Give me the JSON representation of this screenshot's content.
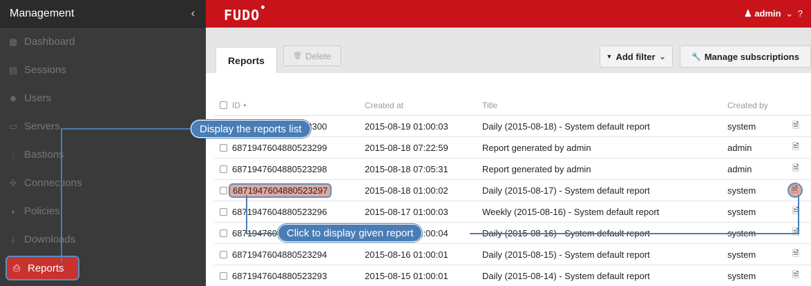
{
  "sidebar": {
    "title": "Management",
    "collapse_glyph": "‹",
    "items": [
      {
        "label": "Dashboard",
        "icon": "dashboard-icon",
        "glyph": "▦"
      },
      {
        "label": "Sessions",
        "icon": "film-icon",
        "glyph": "▤"
      },
      {
        "label": "Users",
        "icon": "users-icon",
        "glyph": "☻"
      },
      {
        "label": "Servers",
        "icon": "server-icon",
        "glyph": "▭"
      },
      {
        "label": "Bastions",
        "icon": "bastion-icon",
        "glyph": "⋮"
      },
      {
        "label": "Connections",
        "icon": "connections-icon",
        "glyph": "✢"
      },
      {
        "label": "Policies",
        "icon": "shield-icon",
        "glyph": "◗"
      },
      {
        "label": "Downloads",
        "icon": "download-icon",
        "glyph": "⤓"
      },
      {
        "label": "Reports",
        "icon": "print-icon",
        "glyph": "⎙",
        "active": true
      }
    ]
  },
  "topbar": {
    "logo": "FUDO",
    "user": "admin",
    "user_glyph": "♟",
    "user_chevron": "⌄",
    "help": "?"
  },
  "toolbar": {
    "tab_label": "Reports",
    "delete_label": "Delete",
    "delete_glyph": "🗑",
    "add_filter_label": "Add filter",
    "add_filter_glyph": "▼",
    "add_filter_chevron": "⌄",
    "subscriptions_label": "Manage subscriptions",
    "subscriptions_glyph": "🔧"
  },
  "table": {
    "headers": {
      "id": "ID",
      "sort_glyph": "▲",
      "created_at": "Created at",
      "title": "Title",
      "created_by": "Created by"
    },
    "rows": [
      {
        "id": "6871947604880523300",
        "created_at": "2015-08-19 01:00:03",
        "title": "Daily (2015-08-18) - System default report",
        "created_by": "system"
      },
      {
        "id": "6871947604880523299",
        "created_at": "2015-08-18 07:22:59",
        "title": "Report generated by admin",
        "created_by": "admin"
      },
      {
        "id": "6871947604880523298",
        "created_at": "2015-08-18 07:05:31",
        "title": "Report generated by admin",
        "created_by": "admin"
      },
      {
        "id": "6871947604880523297",
        "created_at": "2015-08-18 01:00:02",
        "title": "Daily (2015-08-17) - System default report",
        "created_by": "system"
      },
      {
        "id": "6871947604880523296",
        "created_at": "2015-08-17 01:00:03",
        "title": "Weekly (2015-08-16) - System default report",
        "created_by": "system"
      },
      {
        "id": "6871947604880523295",
        "created_at": "2015-08-16 01:00:04",
        "title": "Daily (2015-08-16) - System default report",
        "created_by": "system"
      },
      {
        "id": "6871947604880523294",
        "created_at": "2015-08-16 01:00:01",
        "title": "Daily (2015-08-15) - System default report",
        "created_by": "system"
      },
      {
        "id": "6871947604880523293",
        "created_at": "2015-08-15 01:00:01",
        "title": "Daily (2015-08-14) - System default report",
        "created_by": "system"
      }
    ],
    "action_glyph": "🗎"
  },
  "callouts": {
    "list": "Display the reports list",
    "report": "Click to display given report"
  },
  "colors": {
    "brand_red": "#c8131a",
    "sidebar_bg": "#3a3a3a",
    "callout_blue": "#4a7db5",
    "highlight": "#e3a8a0"
  }
}
